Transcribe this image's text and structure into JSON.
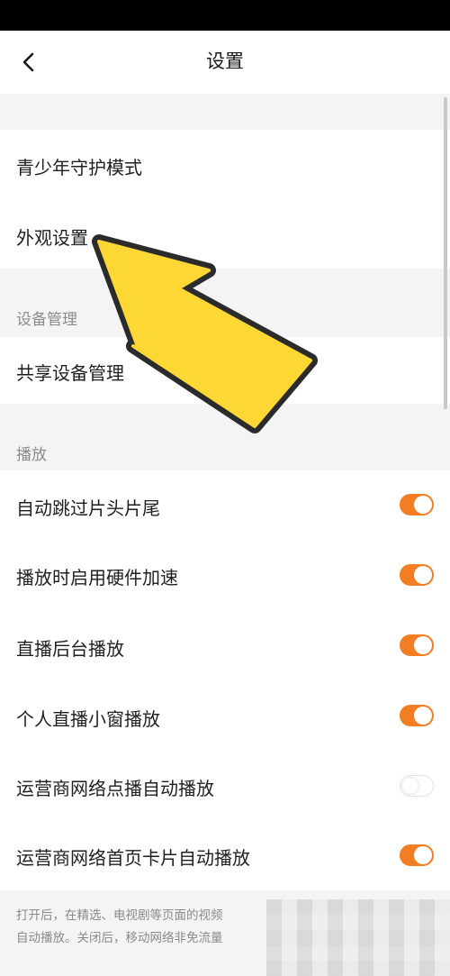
{
  "header": {
    "title": "设置"
  },
  "sections": {
    "general": {
      "items": [
        {
          "label": "青少年守护模式"
        },
        {
          "label": "外观设置"
        }
      ]
    },
    "device": {
      "header": "设备管理",
      "items": [
        {
          "label": "共享设备管理"
        }
      ]
    },
    "playback": {
      "header": "播放",
      "items": [
        {
          "label": "自动跳过片头片尾",
          "enabled": true
        },
        {
          "label": "播放时启用硬件加速",
          "enabled": true
        },
        {
          "label": "直播后台播放",
          "enabled": true
        },
        {
          "label": "个人直播小窗播放",
          "enabled": true
        },
        {
          "label": "运营商网络点播自动播放",
          "enabled": false
        },
        {
          "label": "运营商网络首页卡片自动播放",
          "enabled": true
        }
      ]
    }
  },
  "footer": {
    "line1": "打开后，在精选、电视剧等页面的视频",
    "line2": "自动播放。关闭后，移动网络非免流量"
  },
  "colors": {
    "accent": "#f27d22",
    "background_gap": "#f4f4f6",
    "annotation_arrow": "#fdd835"
  }
}
